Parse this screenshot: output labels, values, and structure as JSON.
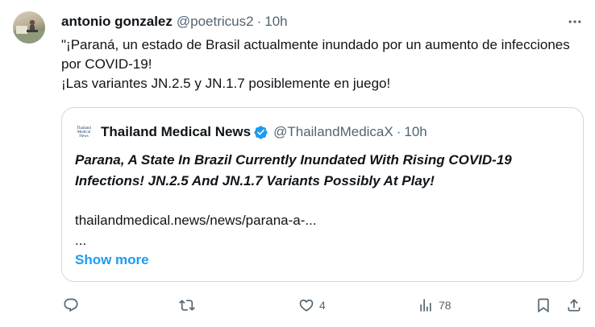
{
  "author": {
    "display_name": "antonio gonzalez",
    "handle": "@poetricus2",
    "separator": "·",
    "time": "10h",
    "avatar_icon": "user-avatar"
  },
  "tweet_text": [
    "\"¡Paraná, un estado de Brasil actualmente inundado por un aumento de infecciones por COVID-19!",
    "¡Las variantes JN.2.5 y JN.1.7 posiblemente en juego!"
  ],
  "quote": {
    "logo_lines": [
      "Thailand",
      "Medical",
      "News"
    ],
    "display_name": "Thailand Medical News",
    "verified_icon": "verified-badge-icon",
    "handle": "@ThailandMedicaX",
    "separator": "·",
    "time": "10h",
    "title": "Parana, A State In Brazil Currently Inundated With Rising COVID-19 Infections! JN.2.5 And JN.1.7 Variants Possibly At Play!",
    "link": "thailandmedical.news/news/parana-a-...",
    "ellipsis": "...",
    "show_more": "Show more"
  },
  "actions": {
    "reply": {
      "icon": "reply-icon",
      "count": ""
    },
    "retweet": {
      "icon": "retweet-icon",
      "count": ""
    },
    "like": {
      "icon": "heart-icon",
      "count": "4"
    },
    "views": {
      "icon": "views-icon",
      "count": "78"
    },
    "bookmark": {
      "icon": "bookmark-icon"
    },
    "share": {
      "icon": "share-icon"
    }
  },
  "colors": {
    "text": "#0f1419",
    "secondary": "#536471",
    "accent": "#1d9bf0",
    "border": "#cfd9de"
  }
}
